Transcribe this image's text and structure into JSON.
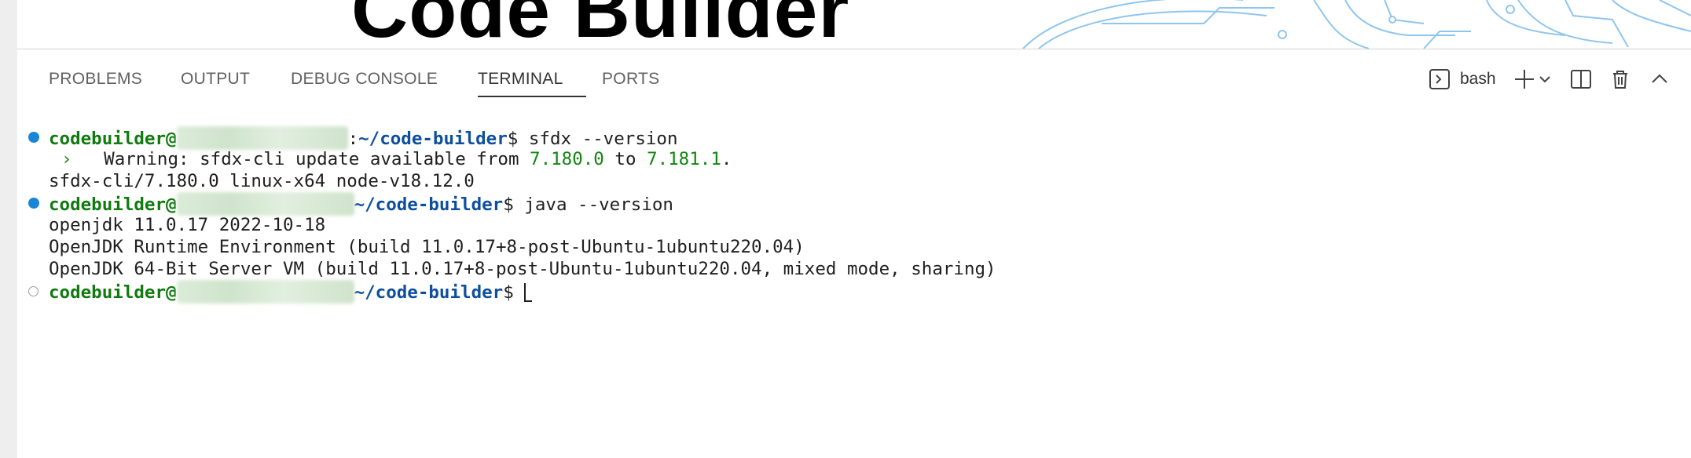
{
  "banner": {
    "title": "Code Builder"
  },
  "panel": {
    "tabs": [
      {
        "label": "PROBLEMS",
        "active": false
      },
      {
        "label": "OUTPUT",
        "active": false
      },
      {
        "label": "DEBUG CONSOLE",
        "active": false
      },
      {
        "label": "TERMINAL",
        "active": true
      },
      {
        "label": "PORTS",
        "active": false
      }
    ],
    "terminal_name": "bash",
    "icons": [
      "terminal-icon",
      "plus-icon",
      "chevron-down-icon",
      "split-icon",
      "trash-icon",
      "chevron-up-icon"
    ]
  },
  "terminal": {
    "prompt_user": "codebuilder@",
    "prompt_path": "~/code-builder",
    "prompt_sep_1": ":",
    "prompt_symbol": "$",
    "cmd1": " sfdx --version",
    "warn_arrow": "›",
    "warn_text_a": "   Warning: sfdx-cli update available from ",
    "warn_from": "7.180.0",
    "warn_to_word": " to ",
    "warn_to": "7.181.1",
    "warn_end": ".",
    "out_sfdx": "sfdx-cli/7.180.0 linux-x64 node-v18.12.0",
    "cmd2": " java --version",
    "java_1": "openjdk 11.0.17 2022-10-18",
    "java_2": "OpenJDK Runtime Environment (build 11.0.17+8-post-Ubuntu-1ubuntu220.04)",
    "java_3": "OpenJDK 64-Bit Server VM (build 11.0.17+8-post-Ubuntu-1ubuntu220.04, mixed mode, sharing)"
  },
  "colors": {
    "accent_blue": "#1a85d6",
    "prompt_green": "#0f7b0f",
    "path_blue": "#0d4f9e",
    "version_green": "#12860f"
  }
}
